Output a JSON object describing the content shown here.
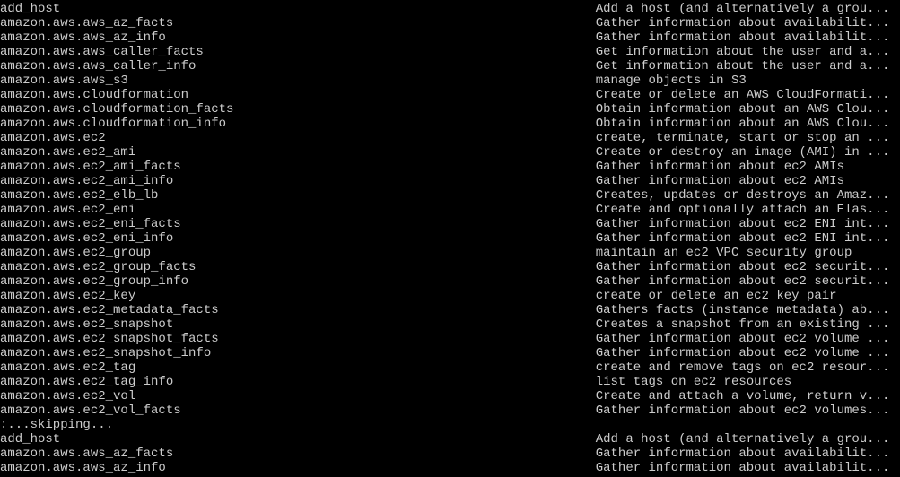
{
  "columns": {
    "name_width_ch": 79
  },
  "rows": [
    {
      "name": "add_host",
      "desc": "Add a host (and alternatively a grou..."
    },
    {
      "name": "amazon.aws.aws_az_facts",
      "desc": "Gather information about availabilit..."
    },
    {
      "name": "amazon.aws.aws_az_info",
      "desc": "Gather information about availabilit..."
    },
    {
      "name": "amazon.aws.aws_caller_facts",
      "desc": "Get information about the user and a..."
    },
    {
      "name": "amazon.aws.aws_caller_info",
      "desc": "Get information about the user and a..."
    },
    {
      "name": "amazon.aws.aws_s3",
      "desc": "manage objects in S3"
    },
    {
      "name": "amazon.aws.cloudformation",
      "desc": "Create or delete an AWS CloudFormati..."
    },
    {
      "name": "amazon.aws.cloudformation_facts",
      "desc": "Obtain information about an AWS Clou..."
    },
    {
      "name": "amazon.aws.cloudformation_info",
      "desc": "Obtain information about an AWS Clou..."
    },
    {
      "name": "amazon.aws.ec2",
      "desc": "create, terminate, start or stop an ..."
    },
    {
      "name": "amazon.aws.ec2_ami",
      "desc": "Create or destroy an image (AMI) in ..."
    },
    {
      "name": "amazon.aws.ec2_ami_facts",
      "desc": "Gather information about ec2 AMIs"
    },
    {
      "name": "amazon.aws.ec2_ami_info",
      "desc": "Gather information about ec2 AMIs"
    },
    {
      "name": "amazon.aws.ec2_elb_lb",
      "desc": "Creates, updates or destroys an Amaz..."
    },
    {
      "name": "amazon.aws.ec2_eni",
      "desc": "Create and optionally attach an Elas..."
    },
    {
      "name": "amazon.aws.ec2_eni_facts",
      "desc": "Gather information about ec2 ENI int..."
    },
    {
      "name": "amazon.aws.ec2_eni_info",
      "desc": "Gather information about ec2 ENI int..."
    },
    {
      "name": "amazon.aws.ec2_group",
      "desc": "maintain an ec2 VPC security group"
    },
    {
      "name": "amazon.aws.ec2_group_facts",
      "desc": "Gather information about ec2 securit..."
    },
    {
      "name": "amazon.aws.ec2_group_info",
      "desc": "Gather information about ec2 securit..."
    },
    {
      "name": "amazon.aws.ec2_key",
      "desc": "create or delete an ec2 key pair"
    },
    {
      "name": "amazon.aws.ec2_metadata_facts",
      "desc": "Gathers facts (instance metadata) ab..."
    },
    {
      "name": "amazon.aws.ec2_snapshot",
      "desc": "Creates a snapshot from an existing ..."
    },
    {
      "name": "amazon.aws.ec2_snapshot_facts",
      "desc": "Gather information about ec2 volume ..."
    },
    {
      "name": "amazon.aws.ec2_snapshot_info",
      "desc": "Gather information about ec2 volume ..."
    },
    {
      "name": "amazon.aws.ec2_tag",
      "desc": "create and remove tags on ec2 resour..."
    },
    {
      "name": "amazon.aws.ec2_tag_info",
      "desc": "list tags on ec2 resources"
    },
    {
      "name": "amazon.aws.ec2_vol",
      "desc": "Create and attach a volume, return v..."
    },
    {
      "name": "amazon.aws.ec2_vol_facts",
      "desc": "Gather information about ec2 volumes..."
    },
    {
      "name": ":...skipping...",
      "desc": ""
    },
    {
      "name": "add_host",
      "desc": "Add a host (and alternatively a grou..."
    },
    {
      "name": "amazon.aws.aws_az_facts",
      "desc": "Gather information about availabilit..."
    },
    {
      "name": "amazon.aws.aws_az_info",
      "desc": "Gather information about availabilit..."
    }
  ]
}
